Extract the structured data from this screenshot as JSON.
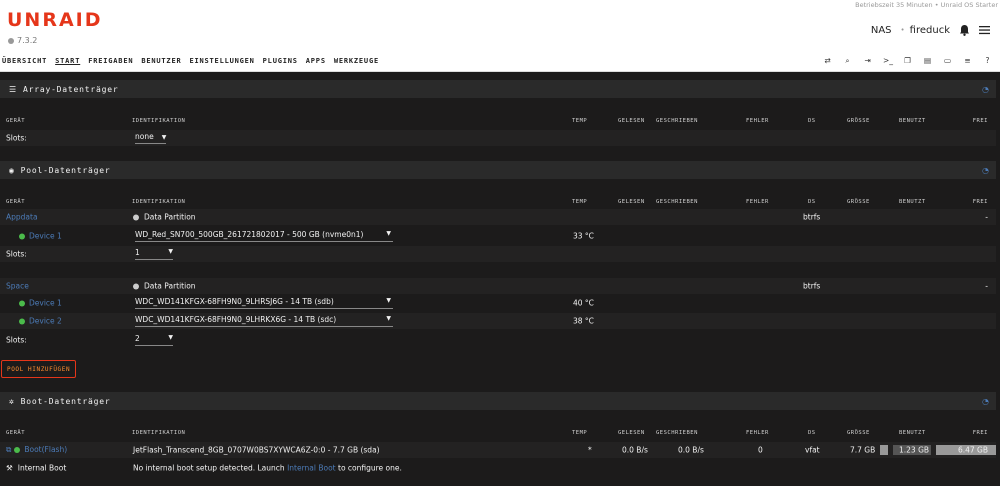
{
  "header": {
    "logo": "UNRAID",
    "version": "7.3.2",
    "uptime": "Betriebszeit 35 Minuten",
    "uptime_sep": "•",
    "license": "Unraid OS Starter",
    "server": "NAS",
    "server_sep": "•",
    "user": "fireduck"
  },
  "nav": {
    "items": [
      "ÜBERSICHT",
      "START",
      "FREIGABEN",
      "BENUTZER",
      "EINSTELLUNGEN",
      "PLUGINS",
      "APPS",
      "WERKZEUGE"
    ],
    "active": "START",
    "icons": [
      "switch-icon",
      "search-icon",
      "logout-icon",
      "terminal-icon",
      "clone-icon",
      "feedback-icon",
      "monitor-icon",
      "log-icon",
      "help-icon"
    ]
  },
  "columns": {
    "device": "GERÄT",
    "identification": "IDENTIFIKATION",
    "temp": "TEMP",
    "reads": "GELESEN",
    "writes": "GESCHRIEBEN",
    "errors": "FEHLER",
    "fs": "DS",
    "size": "GRÖSSE",
    "used": "BENUTZT",
    "free": "FREI"
  },
  "array": {
    "title": "Array-Datenträger",
    "slots_label": "Slots:",
    "slots_value": "none"
  },
  "pool": {
    "title": "Pool-Datenträger",
    "appdata": {
      "name": "Appdata",
      "partition": "Data Partition",
      "fs": "btrfs",
      "free": "-",
      "device_label": "Device 1",
      "device_id": "WD_Red_SN700_500GB_261721802017 - 500 GB (nvme0n1)",
      "device_temp": "33 °C",
      "slots_label": "Slots:",
      "slots_value": "1"
    },
    "space": {
      "name": "Space",
      "partition": "Data Partition",
      "fs": "btrfs",
      "free": "-",
      "devices": [
        {
          "label": "Device 1",
          "id": "WDC_WD141KFGX-68FH9N0_9LHRSJ6G - 14 TB (sdb)",
          "temp": "40 °C"
        },
        {
          "label": "Device 2",
          "id": "WDC_WD141KFGX-68FH9N0_9LHRKX6G - 14 TB (sdc)",
          "temp": "38 °C"
        }
      ],
      "slots_label": "Slots:",
      "slots_value": "2"
    },
    "add_button": "POOL HINZUFÜGEN"
  },
  "boot": {
    "title": "Boot-Datenträger",
    "flash": {
      "name": "Boot(Flash)",
      "id": "JetFlash_Transcend_8GB_0707W0BS7XYWCA6Z-0:0 - 7.7 GB (sda)",
      "temp": "*",
      "reads": "0.0 B/s",
      "writes": "0.0 B/s",
      "errors": "0",
      "fs": "vfat",
      "size": "7.7 GB",
      "used": "1.23 GB",
      "free": "6.47 GB",
      "used_fraction": 0.16
    },
    "internal": {
      "label": "Internal Boot",
      "text_before": "No internal boot setup detected. Launch",
      "link": "Internal Boot",
      "text_after": "to configure one."
    }
  },
  "colors": {
    "accent": "#e5361a",
    "link": "#4c7bb7",
    "online": "#4bbb4b"
  }
}
